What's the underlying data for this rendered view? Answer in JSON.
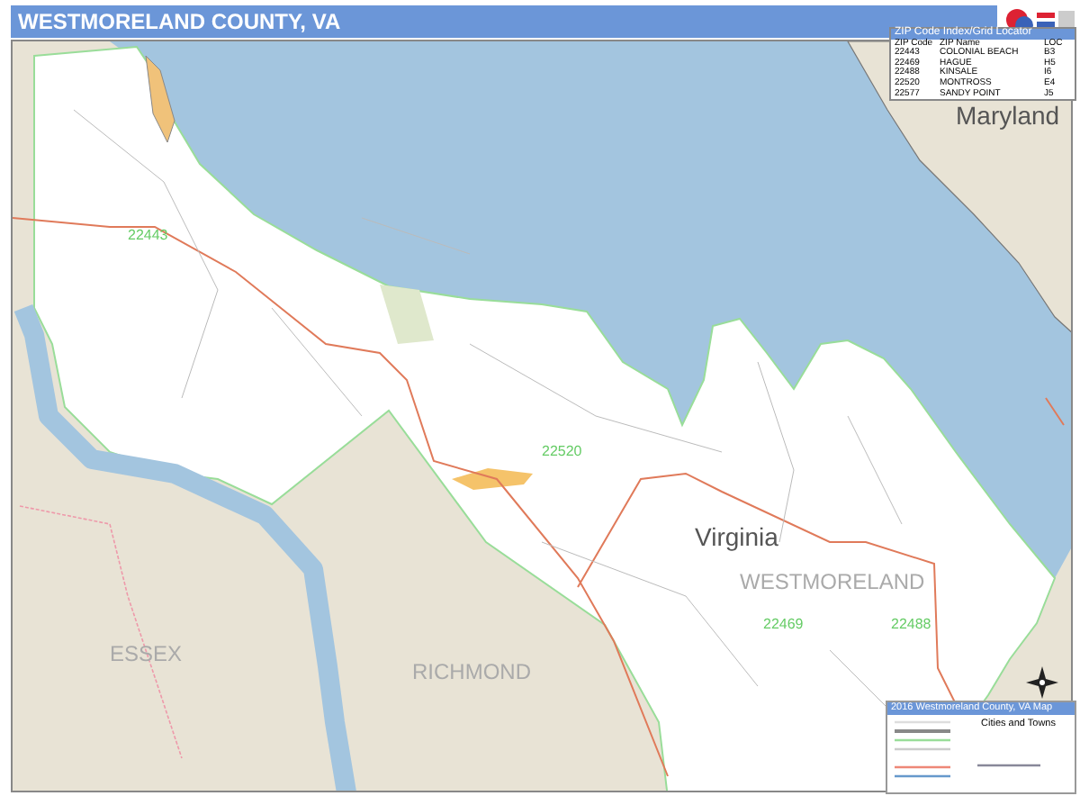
{
  "header": {
    "title": "WESTMORELAND COUNTY, VA"
  },
  "zip_index": {
    "title": "ZIP Code Index/Grid Locator",
    "columns": [
      "ZIP Code",
      "ZIP Name",
      "LOC"
    ],
    "rows": [
      [
        "22443",
        "COLONIAL BEACH",
        "B3"
      ],
      [
        "22469",
        "HAGUE",
        "H5"
      ],
      [
        "22488",
        "KINSALE",
        "I6"
      ],
      [
        "22520",
        "MONTROSS",
        "E4"
      ],
      [
        "22577",
        "SANDY POINT",
        "J5"
      ]
    ]
  },
  "map": {
    "labels": [
      {
        "text": "Maryland",
        "kind": "state"
      },
      {
        "text": "22443",
        "kind": "zip"
      },
      {
        "text": "22520",
        "kind": "zip"
      },
      {
        "text": "Virginia",
        "kind": "state"
      },
      {
        "text": "WESTMORELAND",
        "kind": "county"
      },
      {
        "text": "22469",
        "kind": "zip"
      },
      {
        "text": "22488",
        "kind": "zip"
      },
      {
        "text": "ESSEX",
        "kind": "county"
      },
      {
        "text": "RICHMOND",
        "kind": "county"
      }
    ]
  },
  "legend": {
    "title": "2016 Westmoreland County, VA Map",
    "subtitle": "Cities and Towns"
  }
}
